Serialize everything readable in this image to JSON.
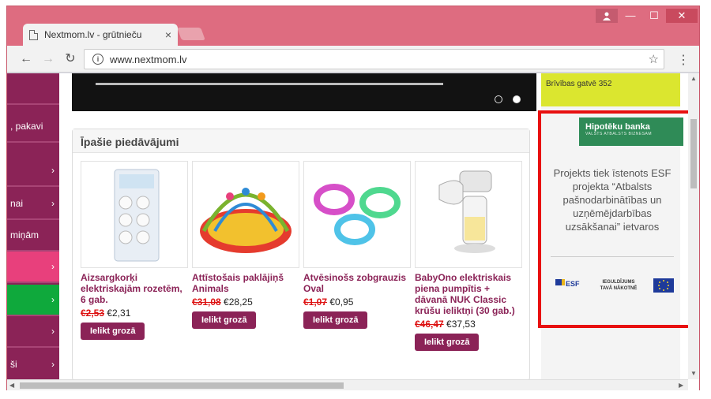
{
  "browser": {
    "tab_title": "Nextmom.lv - grūtnieču ",
    "url": "www.nextmom.lv",
    "tab_close": "×",
    "back": "←",
    "forward": "→",
    "reload": "↻",
    "star": "☆",
    "menu": "⋮",
    "win_user": "👤",
    "win_min": "—",
    "win_max": "☐",
    "win_close": "✕"
  },
  "sidebar": {
    "items": [
      {
        "label": "",
        "chev": ""
      },
      {
        "label": ", pakavi",
        "chev": ""
      },
      {
        "label": "",
        "chev": "›"
      },
      {
        "label": "nai",
        "chev": "›"
      },
      {
        "label": "miņām",
        "chev": ""
      },
      {
        "label": "",
        "chev": "›"
      },
      {
        "label": "",
        "chev": "›"
      },
      {
        "label": "",
        "chev": "›"
      },
      {
        "label": "ši",
        "chev": "›"
      }
    ],
    "colors": [
      "#8b2357",
      "#8b2357",
      "#8b2357",
      "#8b2357",
      "#8b2357",
      "#e8407c",
      "#0fa93c",
      "#8b2357",
      "#8b2357"
    ]
  },
  "offers": {
    "title": "Īpašie piedāvājumi",
    "products": [
      {
        "name": "Aizsargkorķi elektriskajām rozetēm, 6 gab.",
        "old_price": "€2,53",
        "new_price": "€2,31",
        "button": "Ielikt grozā"
      },
      {
        "name": "Attīstošais paklājiņš Animals",
        "old_price": "€31,08",
        "new_price": "€28,25",
        "button": "Ielikt grozā"
      },
      {
        "name": "Atvēsinošs zobgrauzis Oval",
        "old_price": "€1,07",
        "new_price": "€0,95",
        "button": "Ielikt grozā"
      },
      {
        "name": "BabyOno elektriskais piena pumpītis + dāvanā NUK Classic krūšu ieliktņi (30 gab.)",
        "old_price": "€46,47",
        "new_price": "€37,53",
        "button": "Ielikt grozā"
      }
    ]
  },
  "right_ad": {
    "top_text": "Brīvības gatvē 352",
    "bank_name": "Hipotēku banka",
    "bank_sub": "VALSTS ATBALSTS BIZNESAM",
    "text": "Projekts tiek īstenots ESF projekta “Atbalsts pašnodarbinātības un uzņēmējdarbības uzsākšanai” ietvaros",
    "logo_esf": "ESF",
    "logo_inv": "IEGULDĪJUMS TAVĀ NĀKOTNĒ"
  },
  "icons": {
    "tab": "document-icon",
    "info": "info-icon",
    "star": "bookmark-star-icon",
    "menu": "kebab-menu-icon"
  }
}
